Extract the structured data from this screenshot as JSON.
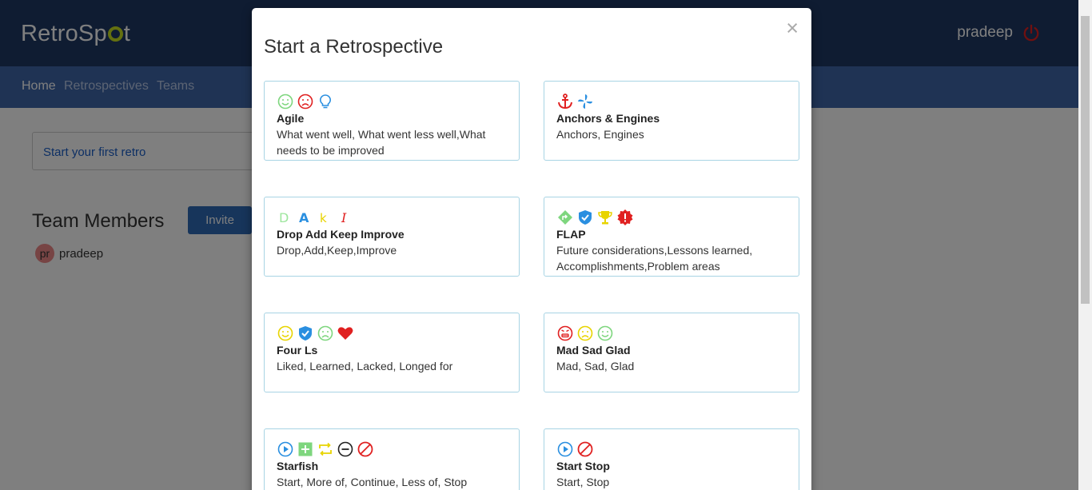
{
  "app": {
    "logo": "RetroSpot",
    "user": "pradeep"
  },
  "nav": {
    "home": "Home",
    "retrospectives": "Retrospectives",
    "teams": "Teams"
  },
  "main": {
    "first_retro": "Start your first retro",
    "team_title": "Team Members",
    "invite_label": "Invite",
    "member": {
      "initials": "pr",
      "name": "pradeep"
    }
  },
  "modal": {
    "title": "Start a Retrospective",
    "close": "×",
    "cards": [
      {
        "name": "Agile",
        "desc": "What went well, What went less well,What needs to be improved",
        "icons": [
          "smile-icon",
          "frown-icon",
          "lightbulb-icon"
        ]
      },
      {
        "name": "Anchors & Engines",
        "desc": "Anchors, Engines",
        "icons": [
          "anchor-icon",
          "fan-icon"
        ]
      },
      {
        "name": "Drop Add Keep Improve",
        "desc": "Drop,Add,Keep,Improve",
        "icons": [
          "letter-d-icon",
          "letter-a-icon",
          "letter-k-icon",
          "letter-i-icon"
        ]
      },
      {
        "name": "FLAP",
        "desc": "Future considerations,Lessons learned, Accomplishments,Problem areas",
        "icons": [
          "direction-sign-icon",
          "shield-check-icon",
          "trophy-icon",
          "alert-badge-icon"
        ]
      },
      {
        "name": "Four Ls",
        "desc": "Liked, Learned, Lacked, Longed for",
        "icons": [
          "smile-icon",
          "shield-check-icon",
          "frown-icon",
          "heart-icon"
        ]
      },
      {
        "name": "Mad Sad Glad",
        "desc": "Mad, Sad, Glad",
        "icons": [
          "angry-icon",
          "sad-icon",
          "glad-icon"
        ]
      },
      {
        "name": "Starfish",
        "desc": "Start, More of, Continue, Less of, Stop",
        "icons": [
          "play-icon",
          "plus-square-icon",
          "repeat-icon",
          "minus-circle-icon",
          "stop-icon"
        ]
      },
      {
        "name": "Start Stop",
        "desc": "Start, Stop",
        "icons": [
          "play-icon",
          "stop-icon"
        ]
      }
    ]
  },
  "colors": {
    "header": "#1f3864",
    "nav": "#3f67a8",
    "card_border": "#a8d4e4",
    "invite": "#2f6bb6"
  }
}
